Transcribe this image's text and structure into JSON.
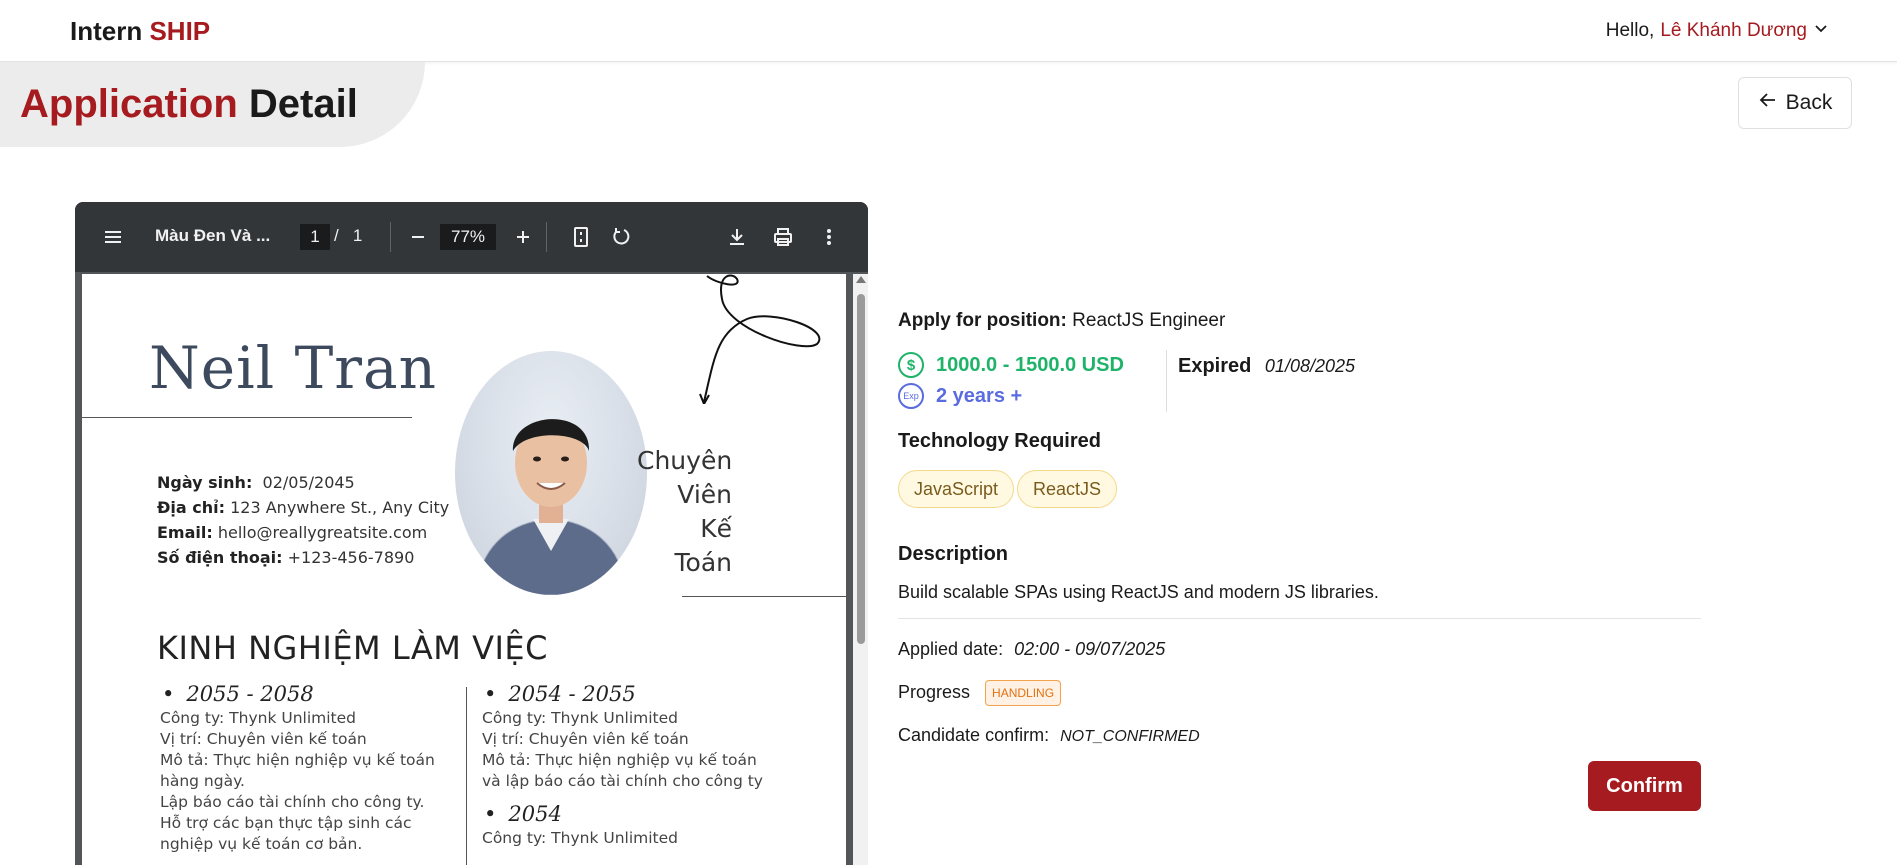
{
  "header": {
    "logo_part1": "Intern",
    "logo_part2": "SHIP",
    "greeting": "Hello,",
    "user_name": "Lê Khánh Dương"
  },
  "page": {
    "title_part1": "Application",
    "title_part2": "Detail",
    "back_label": "Back"
  },
  "pdf_viewer": {
    "file_name": "Màu Đen Và ...",
    "current_page": "1",
    "page_separator": "/",
    "total_pages": "1",
    "zoom": "77%",
    "icons": [
      "menu-icon",
      "zoom-out-icon",
      "zoom-in-icon",
      "fit-page-icon",
      "rotate-icon",
      "download-icon",
      "print-icon",
      "more-vert-icon"
    ]
  },
  "cv": {
    "name": "Neil Tran",
    "role_lines": [
      "Chuyên",
      "Viên",
      "Kế",
      "Toán"
    ],
    "info": [
      {
        "label": "Ngày sinh:",
        "value": "02/05/2045"
      },
      {
        "label": "Địa chỉ:",
        "value": "123 Anywhere St., Any City"
      },
      {
        "label": "Email:",
        "value": "hello@reallygreatsite.com"
      },
      {
        "label": "Số điện thoại:",
        "value": "+123-456-7890"
      }
    ],
    "experience_heading": "KINH NGHIỆM LÀM VIỆC",
    "left_year": "2055 - 2058",
    "left_lines": [
      "Công ty: Thynk Unlimited",
      "Vị trí: Chuyên viên kế toán",
      "Mô tả: Thực hiện nghiệp vụ kế toán",
      "hàng ngày.",
      "Lập báo cáo tài chính cho công ty.",
      "Hỗ trợ các bạn thực tập sinh các",
      "nghiệp vụ kế toán cơ bản."
    ],
    "right_year1": "2054 - 2055",
    "right_lines1": [
      "Công ty: Thynk Unlimited",
      "Vị trí: Chuyên viên kế toán",
      "Mô tả: Thực hiện nghiệp vụ kế toán",
      "và lập báo cáo tài chính cho công ty"
    ],
    "right_year2": "2054",
    "right_lines2": [
      "Công ty: Thynk Unlimited"
    ]
  },
  "application": {
    "position_label": "Apply for position:",
    "position_value": "ReactJS Engineer",
    "salary": "1000.0 - 1500.0 USD",
    "experience": "2 years +",
    "exp_icon_text": "Exp",
    "dollar_icon_text": "$",
    "expired_label": "Expired",
    "expired_value": "01/08/2025",
    "tech_heading": "Technology Required",
    "technologies": [
      "JavaScript",
      "ReactJS"
    ],
    "description_heading": "Description",
    "description": "Build scalable SPAs using ReactJS and modern JS libraries.",
    "applied_label": "Applied date:",
    "applied_value": "02:00 - 09/07/2025",
    "progress_label": "Progress",
    "progress_value": "HANDLING",
    "candidate_label": "Candidate confirm:",
    "candidate_value": "NOT_CONFIRMED",
    "confirm_label": "Confirm"
  },
  "colors": {
    "brand": "#a61b1f",
    "salary": "#1fb36a",
    "experience": "#5b6be0",
    "badge_orange": "#e07214"
  }
}
